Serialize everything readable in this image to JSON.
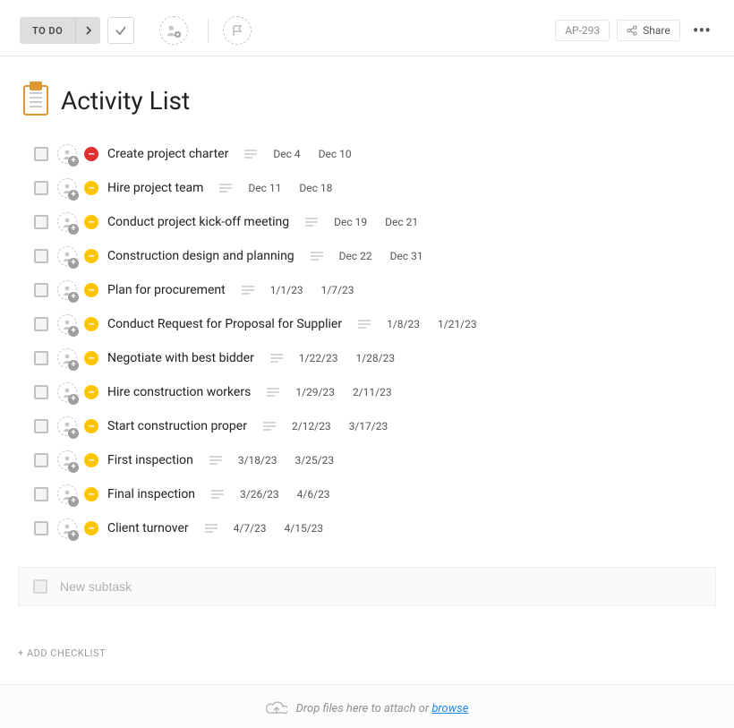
{
  "toolbar": {
    "status_label": "TO DO",
    "issue_id": "AP-293",
    "share_label": "Share"
  },
  "title": "Activity List",
  "tasks": [
    {
      "name": "Create project charter",
      "prio": "red",
      "start": "Dec 4",
      "end": "Dec 10"
    },
    {
      "name": "Hire project team",
      "prio": "yel",
      "start": "Dec 11",
      "end": "Dec 18"
    },
    {
      "name": "Conduct project kick-off meeting",
      "prio": "yel",
      "start": "Dec 19",
      "end": "Dec 21"
    },
    {
      "name": "Construction design and planning",
      "prio": "yel",
      "start": "Dec 22",
      "end": "Dec 31"
    },
    {
      "name": "Plan for procurement",
      "prio": "yel",
      "start": "1/1/23",
      "end": "1/7/23"
    },
    {
      "name": "Conduct Request for Proposal for Supplier",
      "prio": "yel",
      "start": "1/8/23",
      "end": "1/21/23"
    },
    {
      "name": "Negotiate with best bidder",
      "prio": "yel",
      "start": "1/22/23",
      "end": "1/28/23"
    },
    {
      "name": "Hire construction workers",
      "prio": "yel",
      "start": "1/29/23",
      "end": "2/11/23"
    },
    {
      "name": "Start construction proper",
      "prio": "yel",
      "start": "2/12/23",
      "end": "3/17/23"
    },
    {
      "name": "First inspection",
      "prio": "yel",
      "start": "3/18/23",
      "end": "3/25/23"
    },
    {
      "name": "Final inspection",
      "prio": "yel",
      "start": "3/26/23",
      "end": "4/6/23"
    },
    {
      "name": "Client turnover",
      "prio": "yel",
      "start": "4/7/23",
      "end": "4/15/23"
    }
  ],
  "new_subtask_placeholder": "New subtask",
  "add_checklist_label": "+ ADD CHECKLIST",
  "dropzone": {
    "text": "Drop files here to attach or ",
    "link": "browse"
  }
}
